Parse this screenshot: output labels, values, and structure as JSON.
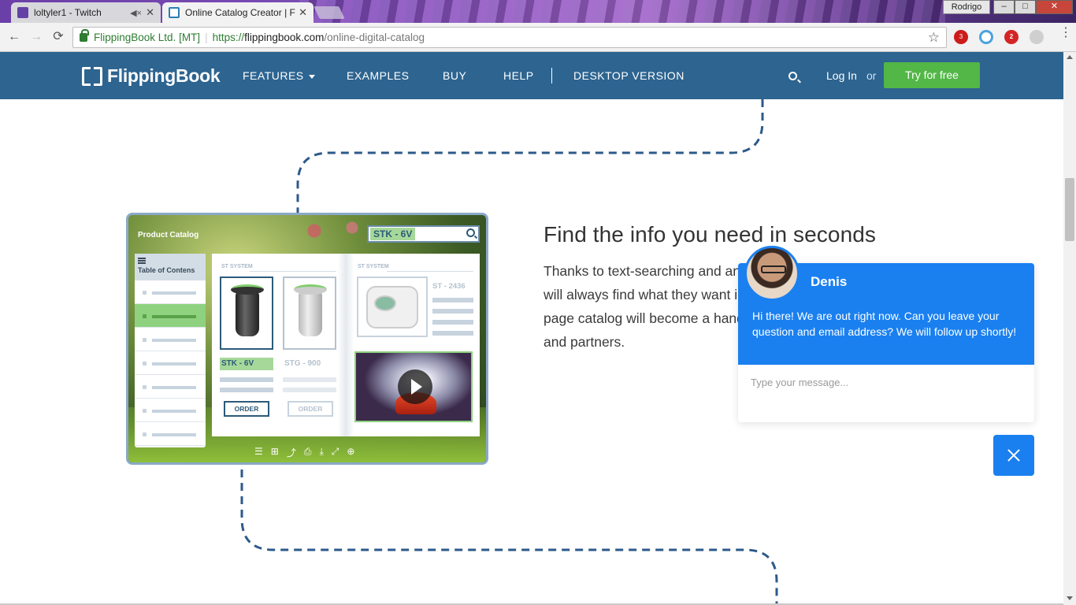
{
  "browser": {
    "tabs": [
      {
        "title": "loltyler1 - Twitch",
        "icon": "twitch-icon"
      },
      {
        "title": "Online Catalog Creator | F",
        "icon": "flippingbook-icon"
      }
    ],
    "profile_name": "Rodrigo",
    "window_controls": {
      "minimize": "–",
      "maximize": "□",
      "close": "✕"
    },
    "nav": {
      "back": "←",
      "forward": "→",
      "reload": "⟳"
    },
    "omnibox": {
      "org": "FlippingBook Ltd. [MT]",
      "separator": "|",
      "scheme": "https://",
      "host": "flippingbook.com",
      "path": "/online-digital-catalog"
    },
    "bookmark": "☆",
    "extensions": [
      {
        "name": "opera-icon",
        "badge": "3"
      },
      {
        "name": "sync-icon",
        "badge": ""
      },
      {
        "name": "adblock-icon",
        "badge": "2"
      },
      {
        "name": "ghost-icon",
        "badge": ""
      }
    ],
    "menu": "⋮"
  },
  "site": {
    "brand": "FlippingBook",
    "nav": {
      "features": "FEATURES",
      "examples": "EXAMPLES",
      "buy": "BUY",
      "help": "HELP",
      "desktop": "DESKTOP VERSION"
    },
    "login": "Log In",
    "or": "or",
    "try_button": "Try for free",
    "colors": {
      "nav_bg": "#2d6490",
      "try_bg": "#52b746",
      "accent": "#1a80f0"
    }
  },
  "mockup": {
    "title": "Product Catalog",
    "search_query": "STK - 6V",
    "toc_title": "Table of Contens",
    "section_left": "ST SYSTEM",
    "section_right": "ST SYSTEM",
    "products": [
      {
        "name": "STK - 6V",
        "order": "ORDER",
        "selected": true
      },
      {
        "name": "STG - 900",
        "order": "ORDER",
        "selected": false
      }
    ],
    "featured": "ST - 2436",
    "bar_icons": [
      "☰",
      "⊞",
      "⤴",
      "⎙",
      "⤓",
      "⤢",
      "⊕"
    ]
  },
  "section": {
    "headline": "Find the info you need in seconds",
    "body": "Thanks to text-searching and an interactive table of contents, people will always find what they want in a matter of seconds. Even a 600-page catalog will become a handy reference tool for your customers and partners."
  },
  "chat": {
    "agent": "Denis",
    "message": "Hi there! We are out right now. Can you leave your question and email address? We will follow up shortly!",
    "placeholder": "Type your message..."
  }
}
